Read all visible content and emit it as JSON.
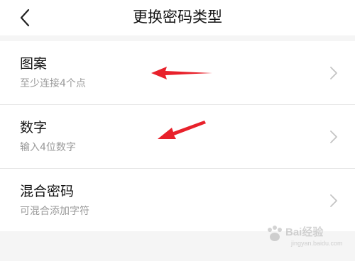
{
  "header": {
    "title": "更换密码类型",
    "back_icon": "chevron-left-icon"
  },
  "options": [
    {
      "title": "图案",
      "subtitle": "至少连接4个点"
    },
    {
      "title": "数字",
      "subtitle": "输入4位数字"
    },
    {
      "title": "混合密码",
      "subtitle": "可混合添加字符"
    }
  ],
  "annotations": {
    "arrow_color": "#e8212b"
  },
  "watermark": {
    "brand": "Bai",
    "text": "经验",
    "url": "jingyan.baidu.com"
  }
}
